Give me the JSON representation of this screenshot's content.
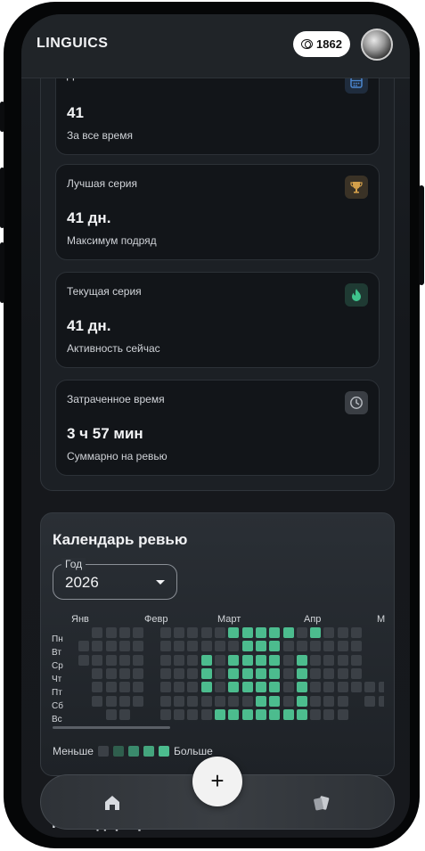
{
  "header": {
    "logo": "LINGUICS",
    "coins": "1862"
  },
  "stats": [
    {
      "label": "Дней активности",
      "value": "41",
      "sub": "За все время",
      "icon": "calendar-icon",
      "color": "#3e6ea8"
    },
    {
      "label": "Лучшая серия",
      "value": "41 дн.",
      "sub": "Максимум подряд",
      "icon": "trophy-icon",
      "color": "#d4a04a"
    },
    {
      "label": "Текущая серия",
      "value": "41 дн.",
      "sub": "Активность сейчас",
      "icon": "flame-icon",
      "color": "#3fc48d"
    },
    {
      "label": "Затраченное время",
      "value": "3 ч 57 мин",
      "sub": "Суммарно на ревью",
      "icon": "clock-icon",
      "color": "#a9adb3"
    }
  ],
  "calendar": {
    "title": "Календарь ревью",
    "year_label": "Год",
    "year": "2026",
    "months": [
      "Янв",
      "Февр",
      "Март",
      "Апр",
      "М"
    ],
    "days": [
      "Пн",
      "Вт",
      "Ср",
      "Чт",
      "Пт",
      "Сб",
      "Вс"
    ],
    "legend_less": "Меньше",
    "legend_more": "Больше",
    "colors": {
      "empty": "#3b4046",
      "active": "#4cbc8e",
      "mid": "#3a8a6c"
    }
  },
  "next_section_title": "Календарь ревью",
  "fab_label": "+"
}
